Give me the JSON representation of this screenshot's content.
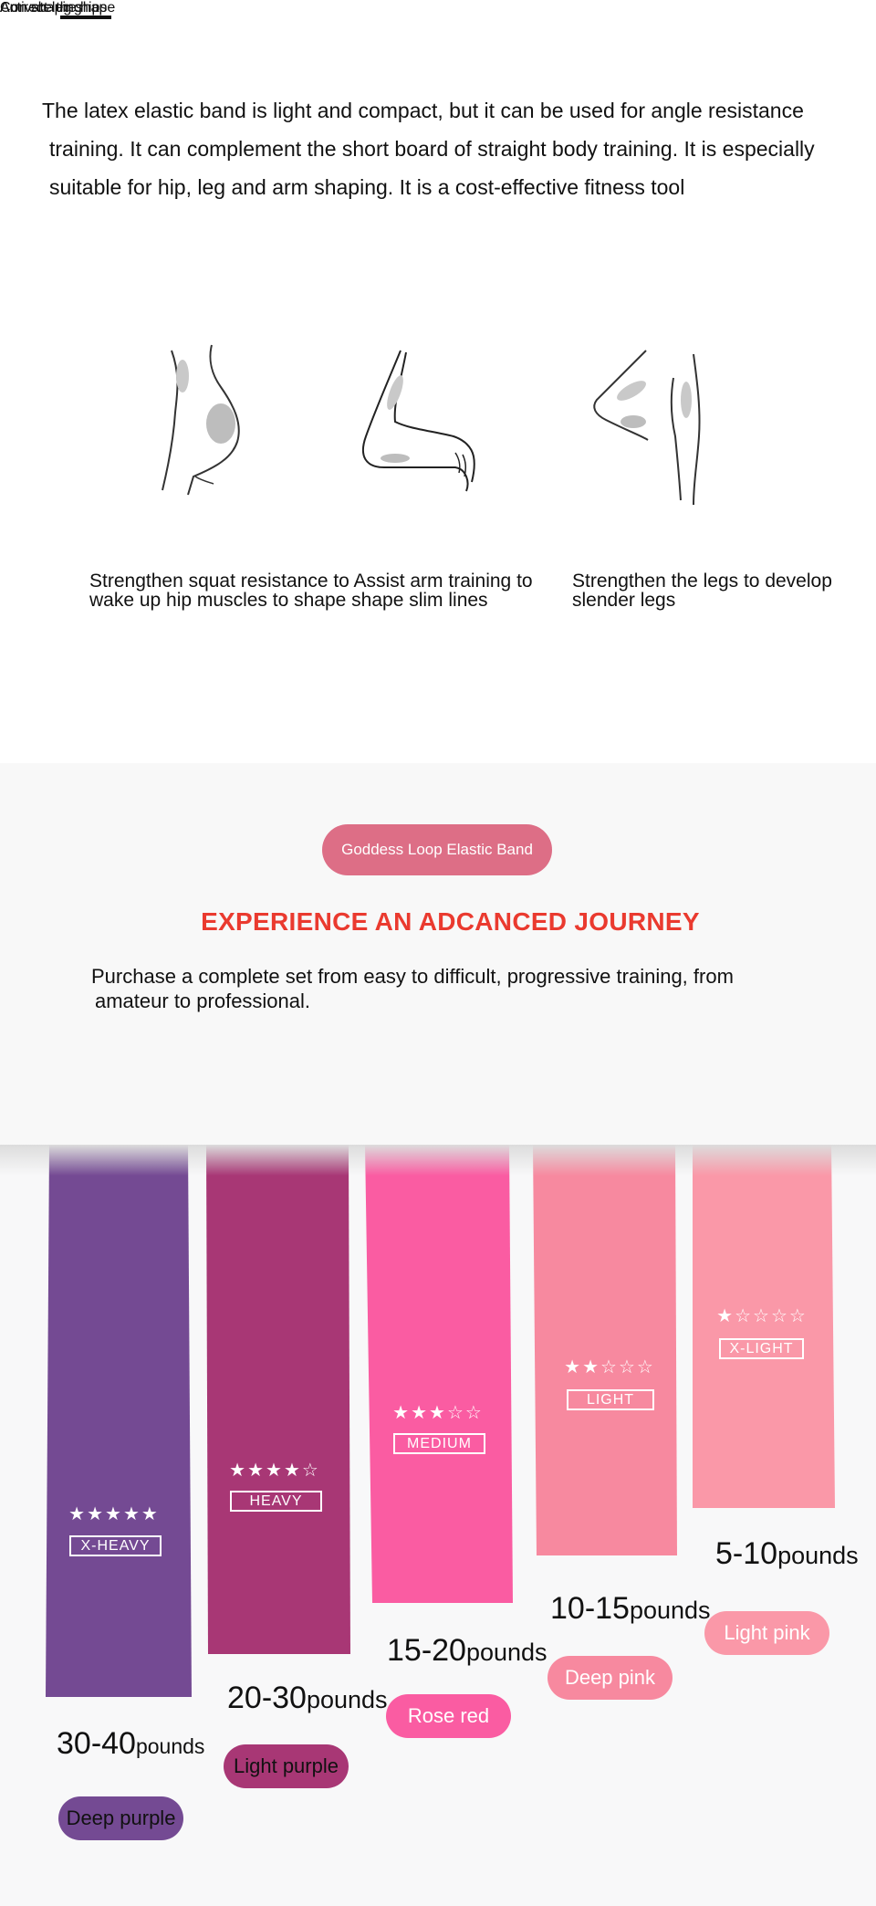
{
  "intro": {
    "line1": "The latex elastic band is light and compact, but it can be used for angle resistance",
    "line2": "training. It can complement the short board of straight body training. It is especially",
    "line3": "suitable for hip, leg and arm shaping. It is a cost-effective fitness tool"
  },
  "features": [
    {
      "icon": "hip-figure-icon",
      "title": "Activate the hips"
    },
    {
      "icon": "arm-figure-icon",
      "title": "Arm shaping"
    },
    {
      "icon": "leg-figure-icon",
      "title": "Correct leg shape"
    }
  ],
  "feature_desc": {
    "left_line1": "Strengthen squat resistance to Assist arm training to",
    "left_line2": "wake up hip muscles to shape shape slim lines",
    "right_line1": "Strengthen the legs to develop",
    "right_line2": "slender legs"
  },
  "promo": {
    "pill": "Goddess Loop Elastic Band",
    "headline": "EXPERIENCE AN ADCANCED JOURNEY",
    "line1": "Purchase a complete set from easy to difficult, progressive training, from",
    "line2": "amateur to professional."
  },
  "bands": [
    {
      "level": "X-HEAVY",
      "stars": "★★★★★",
      "range": "30-40",
      "unit": "pounds",
      "color_name": "Deep purple",
      "color": "#744a93"
    },
    {
      "level": "HEAVY",
      "stars": "★★★★☆",
      "range": "20-30",
      "unit": "pounds",
      "color_name": "Light purple",
      "color": "#a83775"
    },
    {
      "level": "MEDIUM",
      "stars": "★★★☆☆",
      "range": "15-20",
      "unit": "pounds",
      "color_name": "Rose red",
      "color": "#fa5ca2"
    },
    {
      "level": "LIGHT",
      "stars": "★★☆☆☆",
      "range": "10-15",
      "unit": "pounds",
      "color_name": "Deep pink",
      "color": "#f7899f"
    },
    {
      "level": "X-LIGHT",
      "stars": "★☆☆☆☆",
      "range": "5-10",
      "unit": "pounds",
      "color_name": "Light pink",
      "color": "#fa98a8"
    }
  ],
  "colors": {
    "accent_red": "#e8332f",
    "pill_pink": "#dd6e86"
  }
}
